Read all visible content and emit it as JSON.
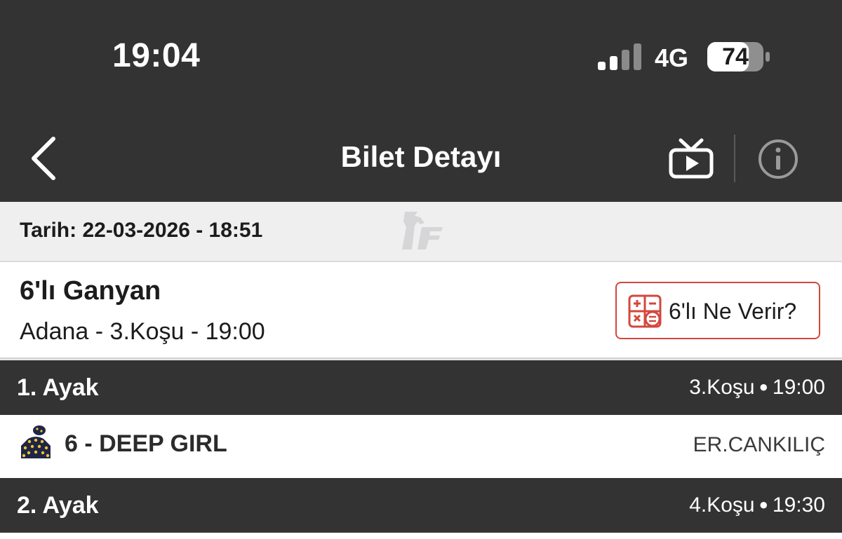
{
  "status": {
    "time": "19:04",
    "network": "4G",
    "battery": "74",
    "battery_level": 0.74
  },
  "nav": {
    "title": "Bilet Detayı"
  },
  "ticket": {
    "date": "Tarih: 22-03-2026 - 18:51",
    "game": "6'lı Ganyan",
    "race_info": "Adana - 3.Koşu - 19:00",
    "calc_button": "6'lı Ne Verir?"
  },
  "legs": [
    {
      "title": "1. Ayak",
      "race": "3.Koşu",
      "time": "19:00",
      "selections": [
        {
          "horse": "6 - DEEP GIRL",
          "jockey": "ER.CANKILIÇ"
        }
      ]
    },
    {
      "title": "2. Ayak",
      "race": "4.Koşu",
      "time": "19:30"
    }
  ],
  "colors": {
    "header_bg": "#333333",
    "accent_red": "#d3473d",
    "date_bar_bg": "#efeff0",
    "silk_navy": "#1f2547",
    "silk_dots": "#f0c52a"
  }
}
